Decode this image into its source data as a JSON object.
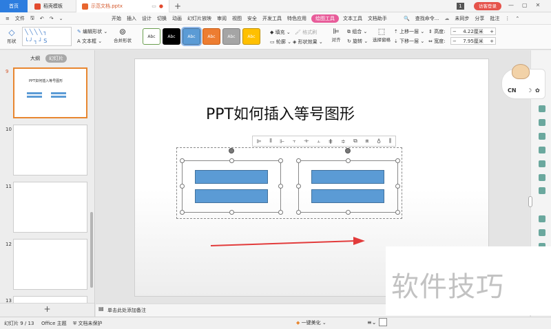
{
  "tabs": [
    {
      "label": "首页"
    },
    {
      "label": "稻壳模板"
    },
    {
      "label": "示范文档.pptx"
    }
  ],
  "title_bar": {
    "page_badge": "1",
    "login": "访客登录"
  },
  "menu": {
    "file": "文件",
    "items": [
      "开始",
      "插入",
      "设计",
      "切换",
      "动画",
      "幻灯片放映",
      "审阅",
      "视图",
      "安全",
      "开发工具",
      "特色应用"
    ],
    "active": "绘图工具",
    "after": [
      "文本工具",
      "文档助手"
    ],
    "search": "查找命令...",
    "sync": "未同步",
    "share": "分享",
    "comment": "批注"
  },
  "ribbon": {
    "shape": "形状",
    "edit_shape": "编辑形状",
    "textbox": "文本框",
    "merge_shape": "合并形状",
    "fill": "填充",
    "format_painter": "格式刷",
    "outline": "轮廓",
    "shape_effect": "形状效果",
    "align": "对齐",
    "group": "组合",
    "rotate": "旋转",
    "selection_pane": "选择窗格",
    "move_up": "上移一层",
    "move_down": "下移一层",
    "height_label": "高度:",
    "height_val": "4.22厘米",
    "width_label": "宽度:",
    "width_val": "7.95厘米",
    "styles": [
      {
        "label": "Abc",
        "bg": "#ffffff",
        "fg": "#333333",
        "border": "#6a9e4f"
      },
      {
        "label": "Abc",
        "bg": "#000000",
        "fg": "#ffffff",
        "border": "#000000"
      },
      {
        "label": "Abc",
        "bg": "#5b9bd5",
        "fg": "#ffffff",
        "border": "#41719c"
      },
      {
        "label": "Abc",
        "bg": "#ed7d31",
        "fg": "#ffffff",
        "border": "#c55a11"
      },
      {
        "label": "Abc",
        "bg": "#a5a5a5",
        "fg": "#ffffff",
        "border": "#7f7f7f"
      },
      {
        "label": "Abc",
        "bg": "#ffc000",
        "fg": "#ffffff",
        "border": "#bf9000"
      }
    ]
  },
  "panel": {
    "outline_tab": "大纲",
    "slides_tab": "幻灯片",
    "slide_numbers": [
      "9",
      "10",
      "11",
      "12",
      "13"
    ],
    "thumb9_title": "PPT如何插入等号图形"
  },
  "slide": {
    "title": "PPT如何插入等号图形"
  },
  "notes_placeholder": "单击此处添加备注",
  "status": {
    "slide_info": "幻灯片 9 / 13",
    "theme": "Office 主题",
    "doc_protect": "文档未保护",
    "beautify": "一键美化"
  },
  "side": {
    "cn_label": "CN"
  },
  "watermark": "软件技巧"
}
